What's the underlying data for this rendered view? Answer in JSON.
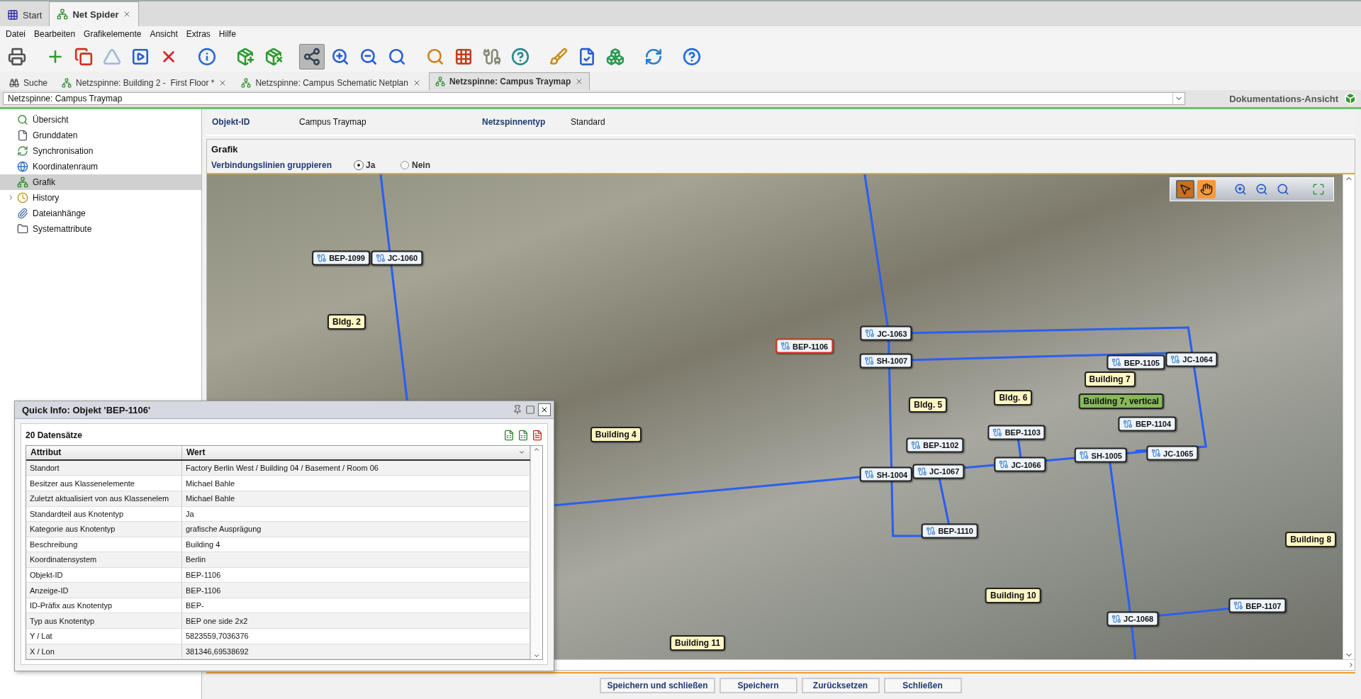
{
  "app_tabs": [
    {
      "label": "Start",
      "selected": false,
      "closable": false
    },
    {
      "label": "Net Spider",
      "selected": true,
      "closable": true
    }
  ],
  "menu": [
    "Datei",
    "Bearbeiten",
    "Grafikelemente",
    "Ansicht",
    "Extras",
    "Hilfe"
  ],
  "toolbar": [
    {
      "kind": "print",
      "selected": false
    },
    {
      "kind": "add",
      "selected": false
    },
    {
      "kind": "copy",
      "selected": false
    },
    {
      "kind": "up",
      "selected": false
    },
    {
      "kind": "run",
      "selected": false
    },
    {
      "kind": "delete",
      "selected": false
    },
    {
      "kind": "info",
      "selected": false
    },
    {
      "kind": "add-cube",
      "selected": false
    },
    {
      "kind": "delete-cube",
      "selected": false
    },
    {
      "kind": "layout",
      "selected": true
    },
    {
      "kind": "zoom-in",
      "selected": false
    },
    {
      "kind": "zoom-out",
      "selected": false
    },
    {
      "kind": "zoom-reset",
      "selected": false
    },
    {
      "kind": "search",
      "selected": false
    },
    {
      "kind": "grid",
      "selected": false
    },
    {
      "kind": "cable",
      "selected": false
    },
    {
      "kind": "help-link",
      "selected": false
    },
    {
      "kind": "edit",
      "selected": false
    },
    {
      "kind": "checklist",
      "selected": false
    },
    {
      "kind": "cubes",
      "selected": false
    },
    {
      "kind": "refresh",
      "selected": false
    },
    {
      "kind": "help",
      "selected": false
    }
  ],
  "doc_tabs": [
    {
      "label": "Suche",
      "selected": false,
      "closable": false
    },
    {
      "label": "Netzspinne: Building 2 -  First Floor *",
      "selected": false,
      "closable": true
    },
    {
      "label": "Netzspinne: Campus Schematic Netplan",
      "selected": false,
      "closable": true
    },
    {
      "label": "Netzspinne: Campus Traymap",
      "selected": true,
      "closable": true
    }
  ],
  "object_select": {
    "value": "Netzspinne: Campus Traymap"
  },
  "view_mode": "Dokumentations-Ansicht",
  "sidebar": {
    "items": [
      {
        "label": "Übersicht",
        "selected": false
      },
      {
        "label": "Grunddaten",
        "selected": false
      },
      {
        "label": "Synchronisation",
        "selected": false
      },
      {
        "label": "Koordinatenraum",
        "selected": false
      },
      {
        "label": "Grafik",
        "selected": true
      },
      {
        "label": "History",
        "selected": false,
        "expanded": false
      },
      {
        "label": "Dateianhänge",
        "selected": false
      },
      {
        "label": "Systemattribute",
        "selected": false
      }
    ]
  },
  "header": {
    "fields": [
      {
        "label": "Objekt-ID",
        "value": "Campus Traymap"
      },
      {
        "label": "Netzspinnentyp",
        "value": "Standard"
      }
    ]
  },
  "grafik": {
    "title": "Grafik",
    "grouping": {
      "label": "Verbindungslinien gruppieren",
      "options": [
        {
          "label": "Ja",
          "selected": true
        },
        {
          "label": "Nein",
          "selected": false
        }
      ]
    },
    "map_tools": [
      {
        "kind": "pointer",
        "selected": true
      },
      {
        "kind": "hand",
        "selected": false
      },
      {
        "kind": "zoom-in",
        "selected": false
      },
      {
        "kind": "zoom-out",
        "selected": false
      },
      {
        "kind": "zoom-reset",
        "selected": false
      },
      {
        "kind": "fit",
        "selected": false
      }
    ],
    "nodes": [
      {
        "kind": "port",
        "label": "BEP-1099",
        "selected": false
      },
      {
        "kind": "port",
        "label": "JC-1060",
        "selected": false
      },
      {
        "kind": "building",
        "label": "Bldg. 2",
        "selected": false
      },
      {
        "kind": "port",
        "label": "BEP-1106",
        "selected": true
      },
      {
        "kind": "port",
        "label": "JC-1063",
        "selected": false
      },
      {
        "kind": "port",
        "label": "SH-1007",
        "selected": false
      },
      {
        "kind": "port",
        "label": "BEP-1105",
        "selected": false
      },
      {
        "kind": "port",
        "label": "JC-1064",
        "selected": false
      },
      {
        "kind": "building",
        "label": "Building 7",
        "selected": false
      },
      {
        "kind": "building-alt",
        "label": "Building 7, vertical",
        "selected": false
      },
      {
        "kind": "building",
        "label": "Bldg. 5",
        "selected": false
      },
      {
        "kind": "building",
        "label": "Bldg. 6",
        "selected": false
      },
      {
        "kind": "building",
        "label": "Building 4",
        "selected": false
      },
      {
        "kind": "port",
        "label": "BEP-1103",
        "selected": false
      },
      {
        "kind": "port",
        "label": "BEP-1104",
        "selected": false
      },
      {
        "kind": "port",
        "label": "BEP-1102",
        "selected": false
      },
      {
        "kind": "port",
        "label": "JC-1065",
        "selected": false
      },
      {
        "kind": "port",
        "label": "SH-1005",
        "selected": false
      },
      {
        "kind": "port",
        "label": "JC-1066",
        "selected": false
      },
      {
        "kind": "port",
        "label": "JC-1067",
        "selected": false
      },
      {
        "kind": "port",
        "label": "SH-1004",
        "selected": false
      },
      {
        "kind": "port",
        "label": "BEP-1110",
        "selected": false
      },
      {
        "kind": "building",
        "label": "Building 8",
        "selected": false
      },
      {
        "kind": "building",
        "label": "Building 10",
        "selected": false
      },
      {
        "kind": "port",
        "label": "BEP-1107",
        "selected": false
      },
      {
        "kind": "port",
        "label": "JC-1068",
        "selected": false
      },
      {
        "kind": "building",
        "label": "Building 11",
        "selected": false
      }
    ]
  },
  "quick_info": {
    "title": "Quick Info: Objekt 'BEP-1106'",
    "count": "20 Datensätze",
    "columns": [
      "Attribut",
      "Wert"
    ],
    "rows": [
      [
        "Standort",
        "Factory Berlin West / Building 04 / Basement / Room 06"
      ],
      [
        "Besitzer aus Klassenelemente",
        "Michael Bahle"
      ],
      [
        "Zuletzt aktualisiert von aus Klassenelem",
        "Michael Bahle"
      ],
      [
        "Standardteil aus Knotentyp",
        "Ja"
      ],
      [
        "Kategorie aus Knotentyp",
        "grafische Ausprägung"
      ],
      [
        "Beschreibung",
        "Building 4"
      ],
      [
        "Koordinatensystem",
        "Berlin"
      ],
      [
        "Objekt-ID",
        "BEP-1106"
      ],
      [
        "Anzeige-ID",
        "BEP-1106"
      ],
      [
        "ID-Präfix aus Knotentyp",
        "BEP-"
      ],
      [
        "Typ aus Knotentyp",
        "BEP one side 2x2"
      ],
      [
        "Y / Lat",
        "5823559,7036376"
      ],
      [
        "X / Lon",
        "381346,69538692"
      ]
    ]
  },
  "buttons": [
    "Speichern und schließen",
    "Speichern",
    "Zurücksetzen",
    "Schließen"
  ]
}
